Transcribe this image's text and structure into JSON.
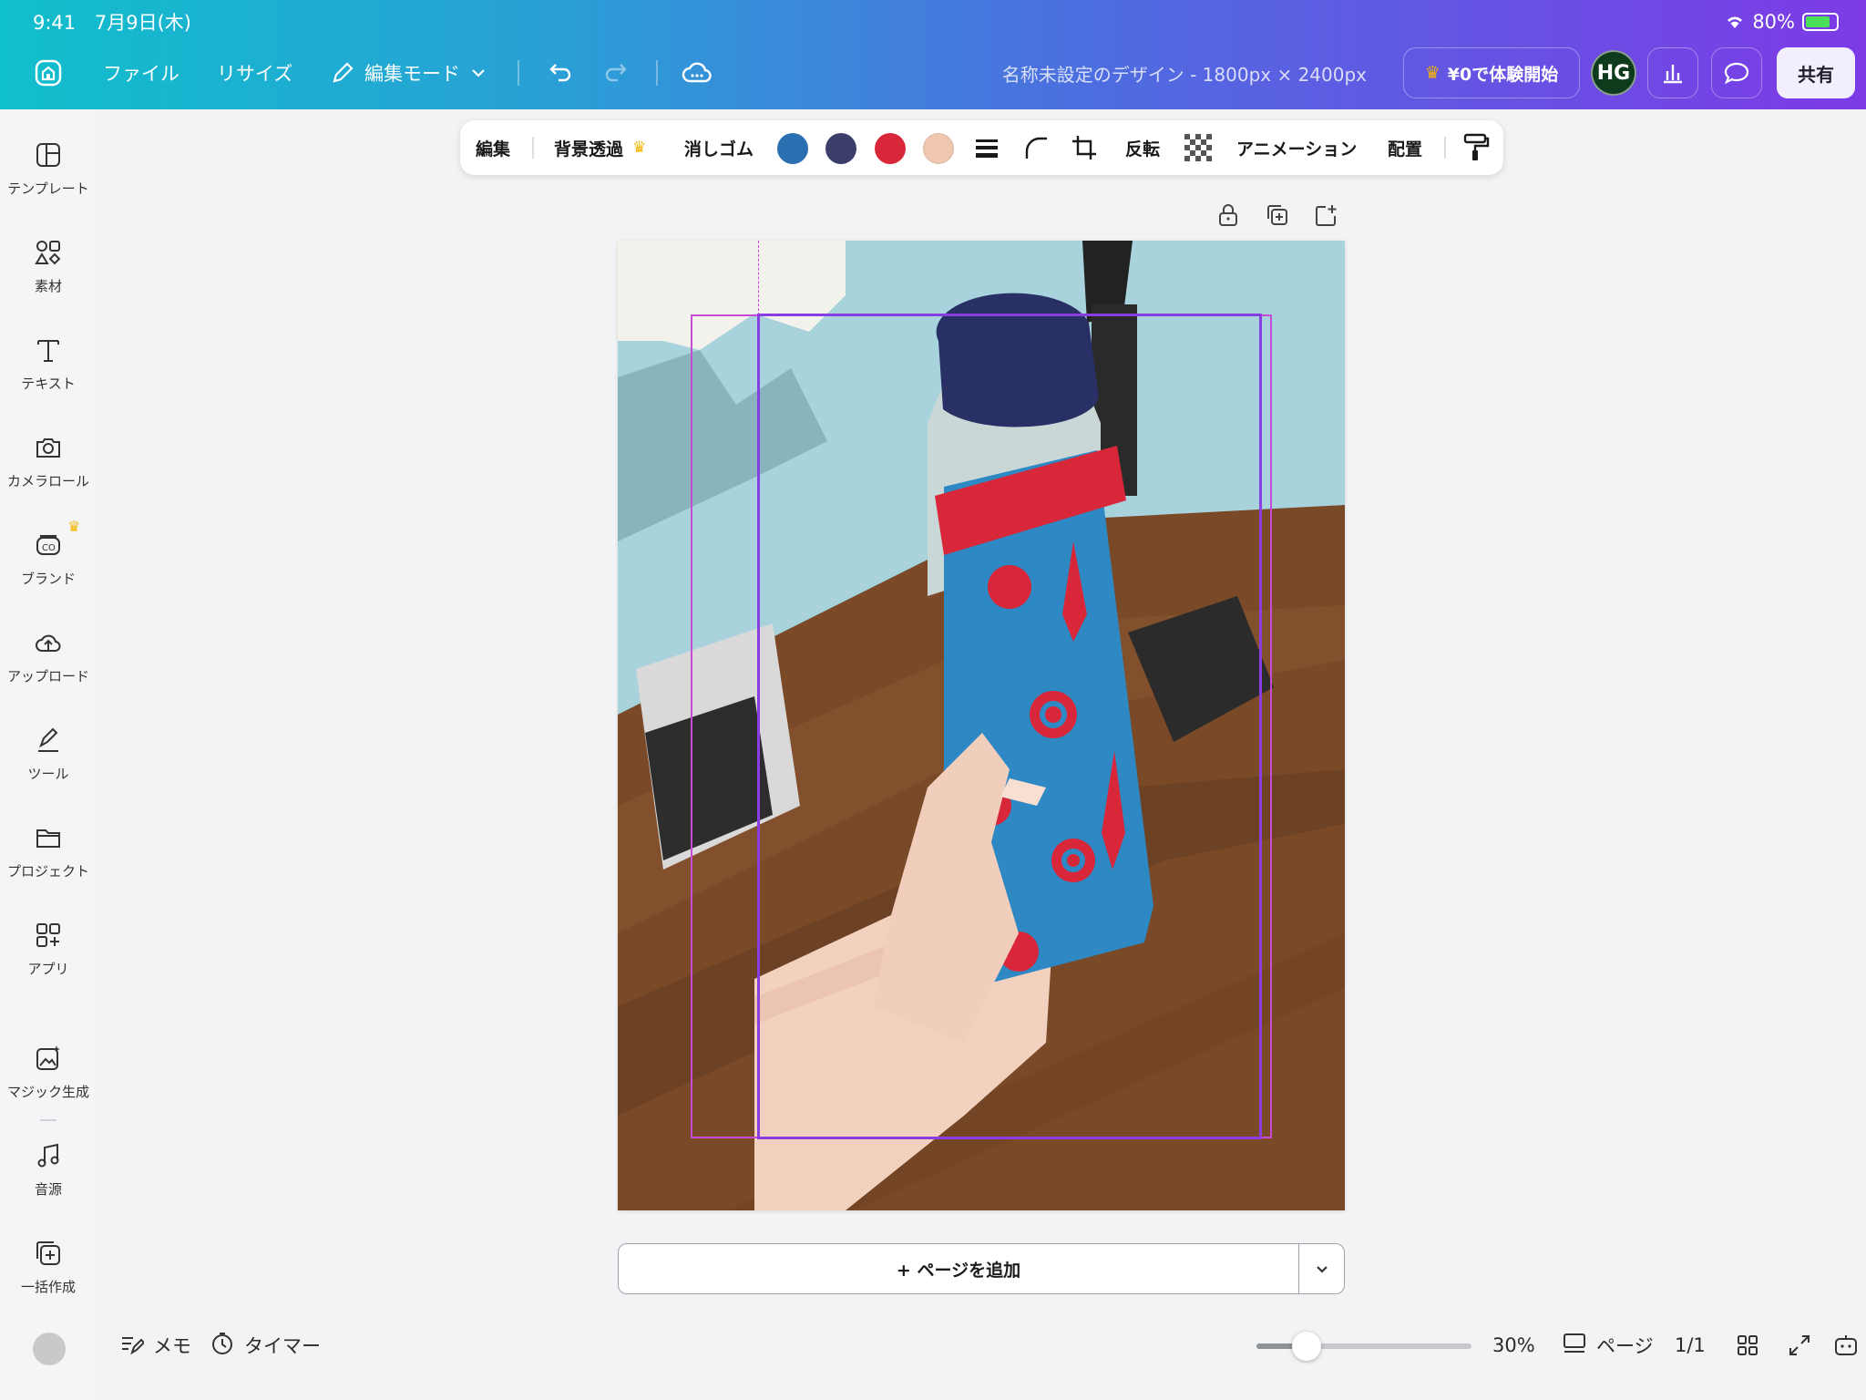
{
  "status": {
    "time": "9:41",
    "date": "7月9日(木)",
    "battery": "80%",
    "battery_level": 0.8
  },
  "header": {
    "file": "ファイル",
    "resize": "リサイズ",
    "edit_mode": "編集モード",
    "doc_title": "名称未設定のデザイン - 1800px × 2400px",
    "trial": "¥0で体験開始",
    "avatar_initials": "HG",
    "share": "共有"
  },
  "sidebar": {
    "items": [
      {
        "label": "テンプレート",
        "icon": "template-icon"
      },
      {
        "label": "素材",
        "icon": "elements-icon"
      },
      {
        "label": "テキスト",
        "icon": "text-icon"
      },
      {
        "label": "カメラロール",
        "icon": "camera-icon"
      },
      {
        "label": "ブランド",
        "icon": "brand-icon"
      },
      {
        "label": "アップロード",
        "icon": "upload-icon"
      },
      {
        "label": "ツール",
        "icon": "tools-icon"
      },
      {
        "label": "プロジェクト",
        "icon": "folder-icon"
      },
      {
        "label": "アプリ",
        "icon": "apps-icon"
      },
      {
        "label": "マジック生成",
        "icon": "magic-icon"
      },
      {
        "label": "音源",
        "icon": "music-icon"
      },
      {
        "label": "一括作成",
        "icon": "bulk-create-icon"
      }
    ]
  },
  "context_toolbar": {
    "edit": "編集",
    "bg_remove": "背景透過",
    "eraser": "消しゴム",
    "colors": [
      "#2a6fb0",
      "#3c3d6b",
      "#d9273a",
      "#efc7b0"
    ],
    "flip": "反転",
    "animation": "アニメーション",
    "position": "配置"
  },
  "canvas": {
    "add_page": "+ ページを追加"
  },
  "bottom": {
    "notes": "メモ",
    "timer": "タイマー",
    "zoom": "30%",
    "zoom_level": 0.3,
    "pages_label": "ページ",
    "page_count": "1/1"
  },
  "colors": {
    "accent": "#8a3de0",
    "selection": "#c74bd6",
    "crown": "#f4b400"
  }
}
